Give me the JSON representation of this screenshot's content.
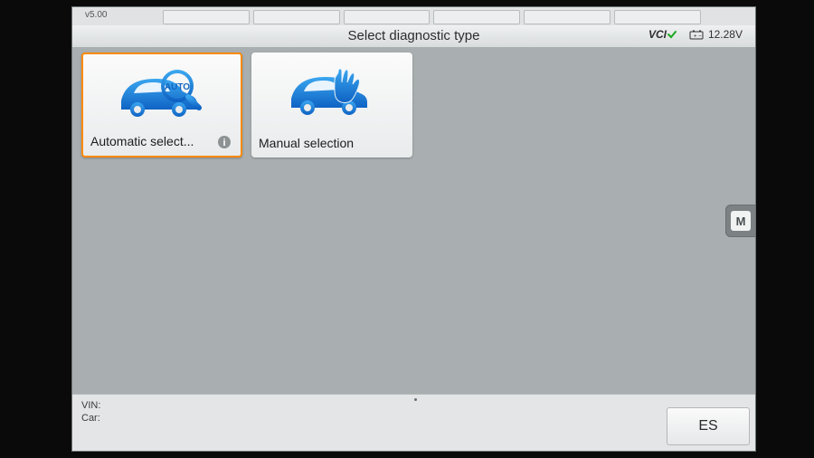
{
  "version": "v5.00",
  "header": {
    "title": "Select diagnostic type",
    "vci_label": "VCI",
    "battery_voltage": "12.28V"
  },
  "tiles": {
    "auto": {
      "label": "Automatic select...",
      "icon": "car-magnify-auto"
    },
    "manual": {
      "label": "Manual selection",
      "icon": "car-hand"
    }
  },
  "side_button": {
    "label": "M"
  },
  "footer": {
    "vin_label": "VIN:",
    "car_label": "Car:",
    "vin_value": "",
    "car_value": "",
    "esc_label": "ES"
  }
}
